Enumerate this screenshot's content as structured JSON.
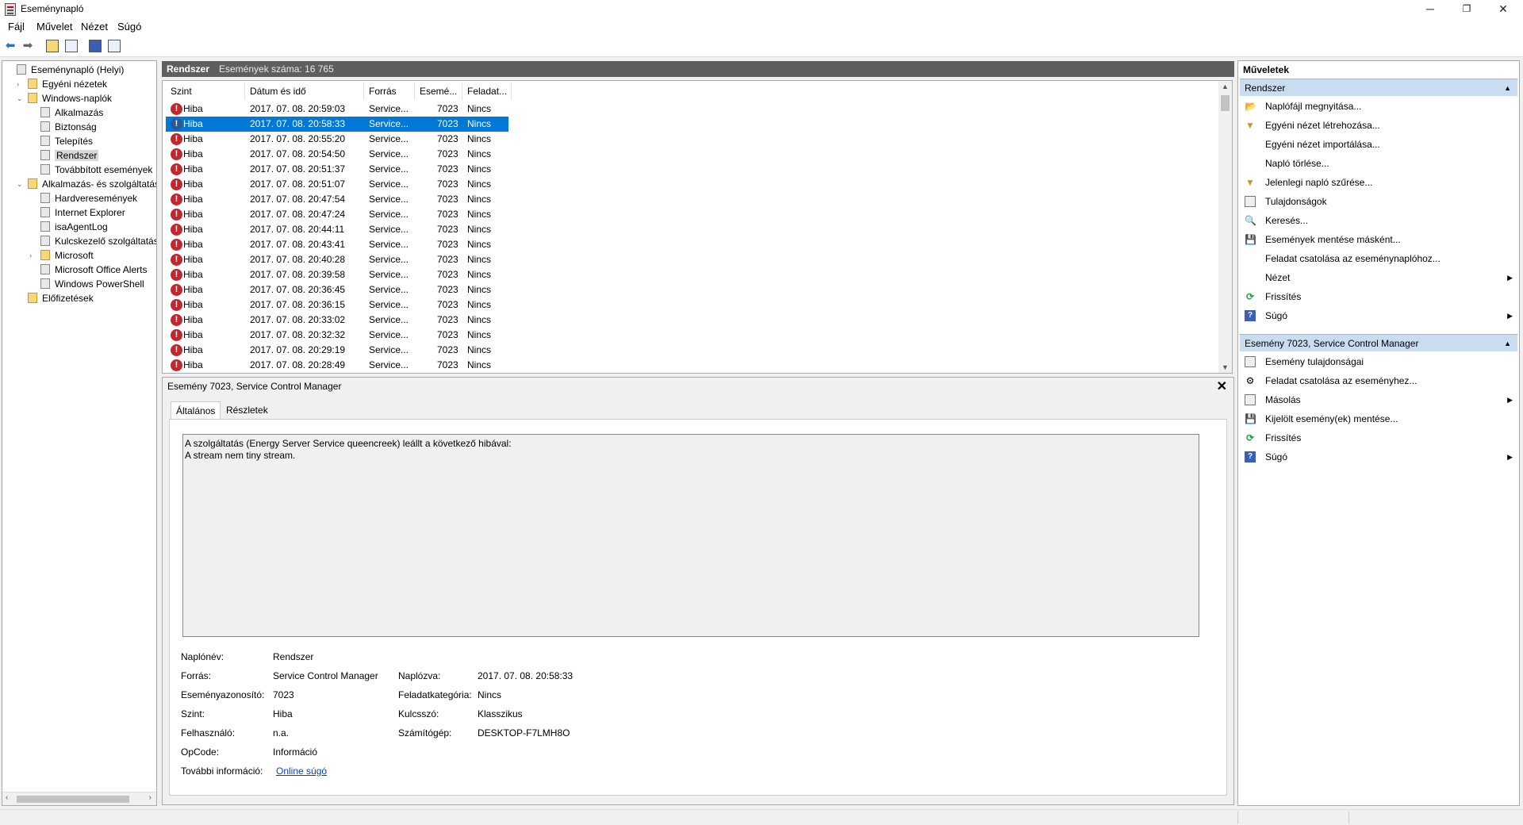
{
  "window": {
    "title": "Eseménynapló",
    "minimize": "─",
    "maximize": "❐",
    "close": "✕"
  },
  "menu": [
    "Fájl",
    "Művelet",
    "Nézet",
    "Súgó"
  ],
  "tree": [
    {
      "label": "Eseménynapló (Helyi)",
      "level": 0,
      "arrow": "",
      "icon": "log",
      "selected": false
    },
    {
      "label": "Egyéni nézetek",
      "level": 1,
      "arrow": "›",
      "icon": "folder",
      "selected": false
    },
    {
      "label": "Windows-naplók",
      "level": 1,
      "arrow": "⌄",
      "icon": "folder",
      "selected": false
    },
    {
      "label": "Alkalmazás",
      "level": 2,
      "arrow": "",
      "icon": "log",
      "selected": false
    },
    {
      "label": "Biztonság",
      "level": 2,
      "arrow": "",
      "icon": "log",
      "selected": false
    },
    {
      "label": "Telepítés",
      "level": 2,
      "arrow": "",
      "icon": "log",
      "selected": false
    },
    {
      "label": "Rendszer",
      "level": 2,
      "arrow": "",
      "icon": "log",
      "selected": true
    },
    {
      "label": "Továbbított események",
      "level": 2,
      "arrow": "",
      "icon": "log",
      "selected": false
    },
    {
      "label": "Alkalmazás- és szolgáltatásna",
      "level": 1,
      "arrow": "⌄",
      "icon": "folder",
      "selected": false
    },
    {
      "label": "Hardveresemények",
      "level": 2,
      "arrow": "",
      "icon": "log",
      "selected": false
    },
    {
      "label": "Internet Explorer",
      "level": 2,
      "arrow": "",
      "icon": "log",
      "selected": false
    },
    {
      "label": "isaAgentLog",
      "level": 2,
      "arrow": "",
      "icon": "log",
      "selected": false
    },
    {
      "label": "Kulcskezelő szolgáltatás",
      "level": 2,
      "arrow": "",
      "icon": "log",
      "selected": false
    },
    {
      "label": "Microsoft",
      "level": 2,
      "arrow": "›",
      "icon": "folder",
      "selected": false
    },
    {
      "label": "Microsoft Office Alerts",
      "level": 2,
      "arrow": "",
      "icon": "log",
      "selected": false
    },
    {
      "label": "Windows PowerShell",
      "level": 2,
      "arrow": "",
      "icon": "log",
      "selected": false
    },
    {
      "label": "Előfizetések",
      "level": 1,
      "arrow": "",
      "icon": "folder",
      "selected": false
    }
  ],
  "center": {
    "log_name": "Rendszer",
    "count_text": "Események száma: 16 765",
    "columns": [
      "Szint",
      "Dátum és idő",
      "Forrás",
      "Esemé...",
      "Feladat..."
    ],
    "rows": [
      {
        "level": "Hiba",
        "datetime": "2017. 07. 08. 20:59:03",
        "source": "Service...",
        "event_id": "7023",
        "task": "Nincs",
        "selected": false
      },
      {
        "level": "Hiba",
        "datetime": "2017. 07. 08. 20:58:33",
        "source": "Service...",
        "event_id": "7023",
        "task": "Nincs",
        "selected": true
      },
      {
        "level": "Hiba",
        "datetime": "2017. 07. 08. 20:55:20",
        "source": "Service...",
        "event_id": "7023",
        "task": "Nincs",
        "selected": false
      },
      {
        "level": "Hiba",
        "datetime": "2017. 07. 08. 20:54:50",
        "source": "Service...",
        "event_id": "7023",
        "task": "Nincs",
        "selected": false
      },
      {
        "level": "Hiba",
        "datetime": "2017. 07. 08. 20:51:37",
        "source": "Service...",
        "event_id": "7023",
        "task": "Nincs",
        "selected": false
      },
      {
        "level": "Hiba",
        "datetime": "2017. 07. 08. 20:51:07",
        "source": "Service...",
        "event_id": "7023",
        "task": "Nincs",
        "selected": false
      },
      {
        "level": "Hiba",
        "datetime": "2017. 07. 08. 20:47:54",
        "source": "Service...",
        "event_id": "7023",
        "task": "Nincs",
        "selected": false
      },
      {
        "level": "Hiba",
        "datetime": "2017. 07. 08. 20:47:24",
        "source": "Service...",
        "event_id": "7023",
        "task": "Nincs",
        "selected": false
      },
      {
        "level": "Hiba",
        "datetime": "2017. 07. 08. 20:44:11",
        "source": "Service...",
        "event_id": "7023",
        "task": "Nincs",
        "selected": false
      },
      {
        "level": "Hiba",
        "datetime": "2017. 07. 08. 20:43:41",
        "source": "Service...",
        "event_id": "7023",
        "task": "Nincs",
        "selected": false
      },
      {
        "level": "Hiba",
        "datetime": "2017. 07. 08. 20:40:28",
        "source": "Service...",
        "event_id": "7023",
        "task": "Nincs",
        "selected": false
      },
      {
        "level": "Hiba",
        "datetime": "2017. 07. 08. 20:39:58",
        "source": "Service...",
        "event_id": "7023",
        "task": "Nincs",
        "selected": false
      },
      {
        "level": "Hiba",
        "datetime": "2017. 07. 08. 20:36:45",
        "source": "Service...",
        "event_id": "7023",
        "task": "Nincs",
        "selected": false
      },
      {
        "level": "Hiba",
        "datetime": "2017. 07. 08. 20:36:15",
        "source": "Service...",
        "event_id": "7023",
        "task": "Nincs",
        "selected": false
      },
      {
        "level": "Hiba",
        "datetime": "2017. 07. 08. 20:33:02",
        "source": "Service...",
        "event_id": "7023",
        "task": "Nincs",
        "selected": false
      },
      {
        "level": "Hiba",
        "datetime": "2017. 07. 08. 20:32:32",
        "source": "Service...",
        "event_id": "7023",
        "task": "Nincs",
        "selected": false
      },
      {
        "level": "Hiba",
        "datetime": "2017. 07. 08. 20:29:19",
        "source": "Service...",
        "event_id": "7023",
        "task": "Nincs",
        "selected": false
      },
      {
        "level": "Hiba",
        "datetime": "2017. 07. 08. 20:28:49",
        "source": "Service...",
        "event_id": "7023",
        "task": "Nincs",
        "selected": false
      }
    ]
  },
  "detail": {
    "title": "Esemény 7023, Service Control Manager",
    "tabs": [
      "Általános",
      "Részletek"
    ],
    "message_line1": "A szolgáltatás (Energy Server Service queencreek) leállt a következő hibával:",
    "message_line2": "A stream nem tiny stream.",
    "labels": {
      "log_name": "Naplónév:",
      "source": "Forrás:",
      "event_id": "Eseményazonosító:",
      "level": "Szint:",
      "user": "Felhasználó:",
      "opcode": "OpCode:",
      "more_info": "További információ:",
      "logged": "Naplózva:",
      "task_category": "Feladatkategória:",
      "keywords": "Kulcsszó:",
      "computer": "Számítógép:"
    },
    "values": {
      "log_name": "Rendszer",
      "source": "Service Control Manager",
      "event_id": "7023",
      "level": "Hiba",
      "user": "n.a.",
      "opcode": "Információ",
      "more_info_link": "Online súgó",
      "logged": "2017. 07. 08. 20:58:33",
      "task_category": "Nincs",
      "keywords": "Klasszikus",
      "computer": "DESKTOP-F7LMH8O"
    }
  },
  "actions": {
    "title": "Műveletek",
    "section1": "Rendszer",
    "section1_items": [
      {
        "label": "Naplófájl megnyitása...",
        "icon": "open-folder-icon",
        "glyph": "📂",
        "submenu": false
      },
      {
        "label": "Egyéni nézet létrehozása...",
        "icon": "filter-icon",
        "glyph": "▼",
        "submenu": false
      },
      {
        "label": "Egyéni nézet importálása...",
        "icon": "",
        "glyph": "",
        "submenu": false
      },
      {
        "label": "Napló törlése...",
        "icon": "",
        "glyph": "",
        "submenu": false
      },
      {
        "label": "Jelenlegi napló szűrése...",
        "icon": "filter-icon",
        "glyph": "▼",
        "submenu": false
      },
      {
        "label": "Tulajdonságok",
        "icon": "properties-icon",
        "glyph": "",
        "submenu": false
      },
      {
        "label": "Keresés...",
        "icon": "binoculars-icon",
        "glyph": "🔍",
        "submenu": false
      },
      {
        "label": "Események mentése másként...",
        "icon": "save-icon",
        "glyph": "💾",
        "submenu": false
      },
      {
        "label": "Feladat csatolása az eseménynaplóhoz...",
        "icon": "",
        "glyph": "",
        "submenu": false
      },
      {
        "label": "Nézet",
        "icon": "",
        "glyph": "",
        "submenu": true
      },
      {
        "label": "Frissítés",
        "icon": "refresh-icon",
        "glyph": "⟳",
        "submenu": false
      },
      {
        "label": "Súgó",
        "icon": "help-icon",
        "glyph": "?",
        "submenu": true
      }
    ],
    "section2": "Esemény 7023, Service Control Manager",
    "section2_items": [
      {
        "label": "Esemény tulajdonságai",
        "icon": "properties-icon",
        "glyph": "",
        "submenu": false
      },
      {
        "label": "Feladat csatolása az eseményhez...",
        "icon": "task-icon",
        "glyph": "⚙",
        "submenu": false
      },
      {
        "label": "Másolás",
        "icon": "copy-icon",
        "glyph": "",
        "submenu": true
      },
      {
        "label": "Kijelölt esemény(ek) mentése...",
        "icon": "save-icon",
        "glyph": "💾",
        "submenu": false
      },
      {
        "label": "Frissítés",
        "icon": "refresh-icon",
        "glyph": "⟳",
        "submenu": false
      },
      {
        "label": "Súgó",
        "icon": "help-icon",
        "glyph": "?",
        "submenu": true
      }
    ]
  }
}
